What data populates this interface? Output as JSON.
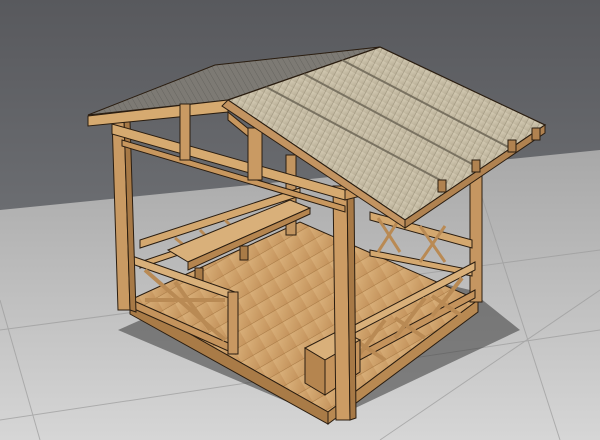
{
  "scene": {
    "subject": "gazebo-3d-model",
    "colors": {
      "background_top": "#5a5c60",
      "background_bottom": "#8c8e92",
      "ground": "#bdbdbd",
      "ground_grid": "#9a9a9a",
      "wood_light": "#d8ad73",
      "wood_mid": "#c1915a",
      "wood_dark": "#9e7242",
      "roof_top": "#c9c0a8",
      "roof_side": "#a69e88",
      "outline": "#2a1d10",
      "shadow": "#3a3a3a"
    }
  }
}
